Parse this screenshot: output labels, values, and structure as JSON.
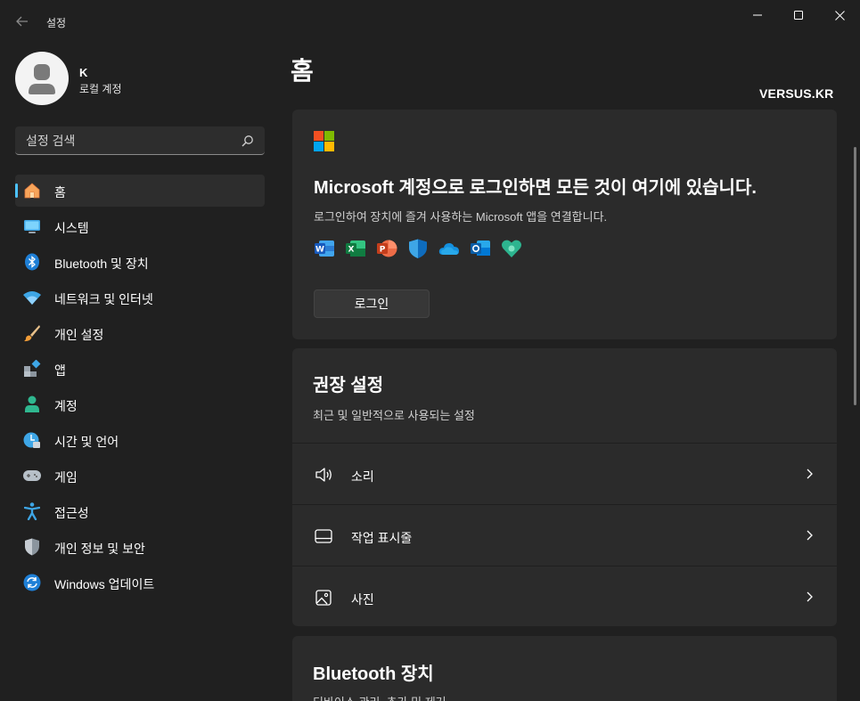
{
  "window": {
    "title": "설정",
    "back_icon": "back-arrow-icon",
    "minimize_icon": "minimize-icon",
    "maximize_icon": "maximize-icon",
    "close_icon": "close-icon"
  },
  "profile": {
    "name": "K",
    "account_type": "로컬 계정"
  },
  "search": {
    "placeholder": "설정 검색"
  },
  "sidebar": {
    "items": [
      {
        "label": "홈",
        "icon": "home-icon",
        "active": true
      },
      {
        "label": "시스템",
        "icon": "system-icon"
      },
      {
        "label": "Bluetooth 및 장치",
        "icon": "bluetooth-icon"
      },
      {
        "label": "네트워크 및 인터넷",
        "icon": "wifi-icon"
      },
      {
        "label": "개인 설정",
        "icon": "brush-icon"
      },
      {
        "label": "앱",
        "icon": "apps-icon"
      },
      {
        "label": "계정",
        "icon": "account-icon"
      },
      {
        "label": "시간 및 언어",
        "icon": "time-language-icon"
      },
      {
        "label": "게임",
        "icon": "gamepad-icon"
      },
      {
        "label": "접근성",
        "icon": "accessibility-icon"
      },
      {
        "label": "개인 정보 및 보안",
        "icon": "shield-icon"
      },
      {
        "label": "Windows 업데이트",
        "icon": "update-icon"
      }
    ]
  },
  "main": {
    "title": "홈",
    "watermark": "VERSUS.KR",
    "signin_card": {
      "title": "Microsoft 계정으로 로그인하면 모든 것이 여기에 있습니다.",
      "description": "로그인하여 장치에 즐겨 사용하는 Microsoft 앱을 연결합니다.",
      "apps": [
        "word-icon",
        "excel-icon",
        "powerpoint-icon",
        "defender-icon",
        "onedrive-icon",
        "outlook-icon",
        "family-icon"
      ],
      "button_label": "로그인"
    },
    "recommended": {
      "title": "권장 설정",
      "description": "최근 및 일반적으로 사용되는 설정",
      "items": [
        {
          "label": "소리",
          "icon": "speaker-icon"
        },
        {
          "label": "작업 표시줄",
          "icon": "taskbar-icon"
        },
        {
          "label": "사진",
          "icon": "picture-icon"
        }
      ]
    },
    "bluetooth": {
      "title": "Bluetooth 장치",
      "description": "디바이스 관리, 추가 및 제거"
    }
  },
  "colors": {
    "background": "#202020",
    "card": "#2b2b2b",
    "accent": "#4cc2ff",
    "ms_red": "#f25022",
    "ms_green": "#7fba00",
    "ms_blue": "#00a4ef",
    "ms_yellow": "#ffb900"
  }
}
